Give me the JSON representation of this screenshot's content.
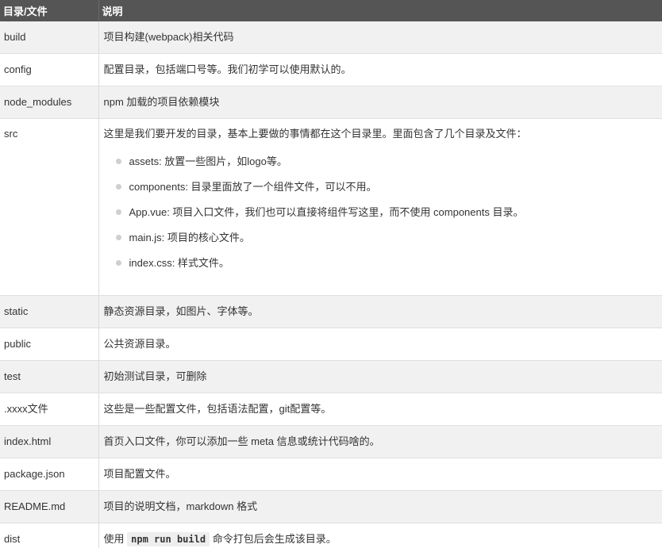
{
  "header": {
    "col1": "目录/文件",
    "col2": "说明"
  },
  "rows": [
    {
      "name": "build",
      "desc": "项目构建(webpack)相关代码"
    },
    {
      "name": "config",
      "desc": "配置目录，包括端口号等。我们初学可以使用默认的。"
    },
    {
      "name": "node_modules",
      "desc": "npm 加载的项目依赖模块"
    },
    {
      "name": "src",
      "desc": "这里是我们要开发的目录，基本上要做的事情都在这个目录里。里面包含了几个目录及文件：",
      "items": [
        "assets: 放置一些图片，如logo等。",
        "components: 目录里面放了一个组件文件，可以不用。",
        "App.vue: 项目入口文件，我们也可以直接将组件写这里，而不使用 components 目录。",
        "main.js: 项目的核心文件。",
        "index.css: 样式文件。"
      ]
    },
    {
      "name": "static",
      "desc": "静态资源目录，如图片、字体等。"
    },
    {
      "name": "public",
      "desc": "公共资源目录。"
    },
    {
      "name": "test",
      "desc": "初始测试目录，可删除"
    },
    {
      "name": ".xxxx文件",
      "desc": "这些是一些配置文件，包括语法配置，git配置等。"
    },
    {
      "name": "index.html",
      "desc": "首页入口文件，你可以添加一些 meta 信息或统计代码啥的。"
    },
    {
      "name": "package.json",
      "desc": "项目配置文件。"
    },
    {
      "name": "README.md",
      "desc": "项目的说明文档，markdown 格式"
    },
    {
      "name": "dist",
      "desc_prefix": "使用",
      "desc_code": "npm run build",
      "desc_suffix": "命令打包后会生成该目录。"
    }
  ]
}
